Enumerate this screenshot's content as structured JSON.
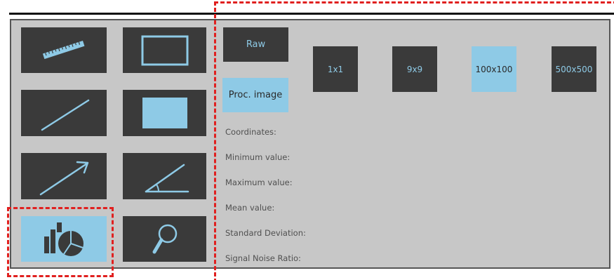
{
  "tools": [
    {
      "name": "ruler-tool",
      "icon": "ruler-icon",
      "active": false
    },
    {
      "name": "rectangle-outline-tool",
      "icon": "rectangle-outline-icon",
      "active": false
    },
    {
      "name": "line-tool",
      "icon": "line-icon",
      "active": false
    },
    {
      "name": "filled-rectangle-tool",
      "icon": "filled-rectangle-icon",
      "active": false
    },
    {
      "name": "arrow-tool",
      "icon": "arrow-icon",
      "active": false
    },
    {
      "name": "angle-tool",
      "icon": "angle-icon",
      "active": false
    },
    {
      "name": "statistics-tool",
      "icon": "statistics-chart-icon",
      "active": true
    },
    {
      "name": "magnifier-tool",
      "icon": "magnifier-icon",
      "active": false
    }
  ],
  "modes": {
    "raw_label": "Raw",
    "proc_label": "Proc. image",
    "selected": "proc"
  },
  "sizes": {
    "items": [
      "1x1",
      "9x9",
      "100x100",
      "500x500"
    ],
    "selected": "100x100"
  },
  "stats": {
    "coordinates": "Coordinates:",
    "minimum": "Minimum value:",
    "maximum": "Maximum value:",
    "mean": "Mean value:",
    "std_dev": "Standard Deviation:",
    "snr": "Signal Noise Ratio:"
  },
  "colors": {
    "panel_bg": "#c7c7c7",
    "button_dark": "#3a3a3a",
    "accent": "#8ecae6",
    "highlight_dash": "#e0201f"
  }
}
